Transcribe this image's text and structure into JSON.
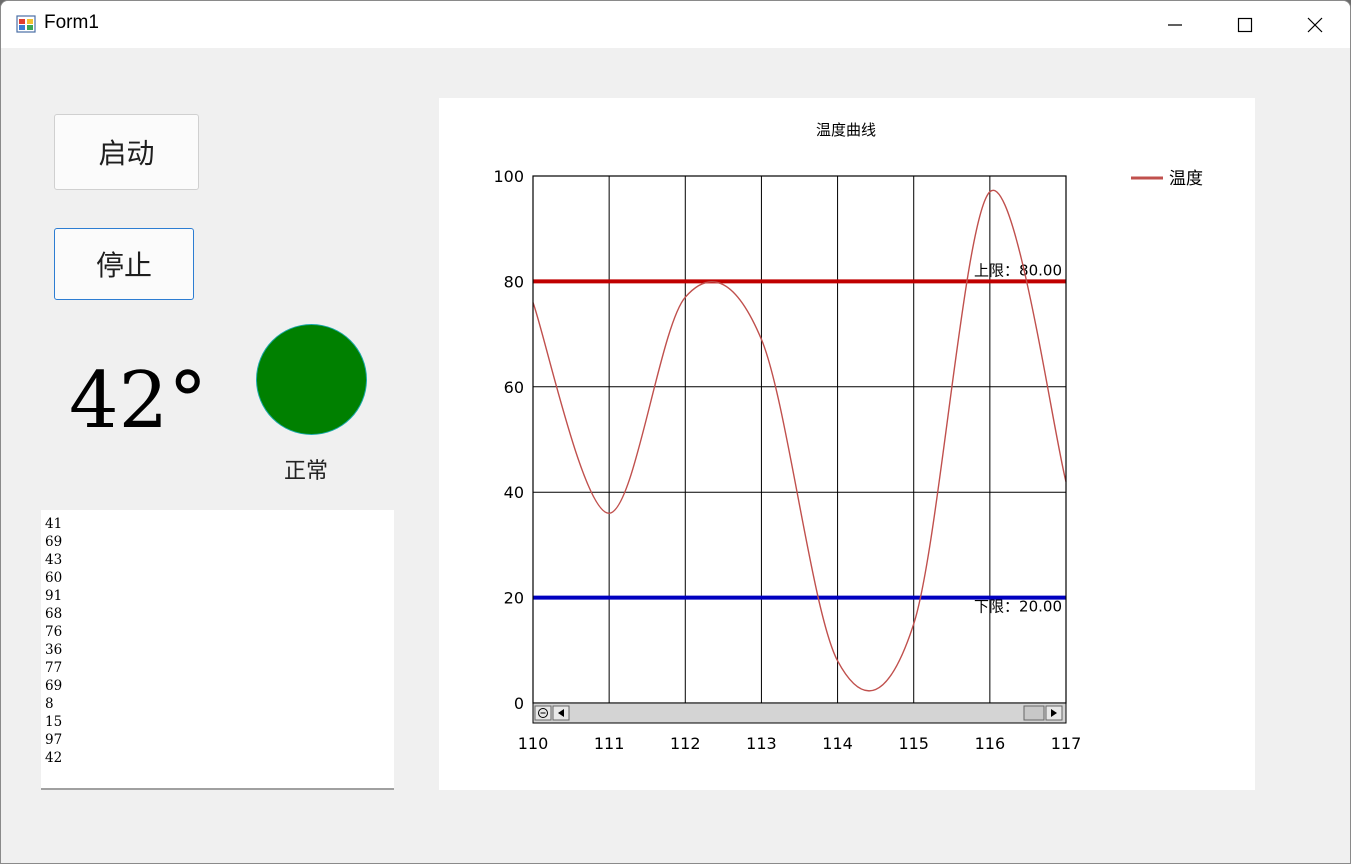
{
  "window": {
    "title": "Form1",
    "controls": {
      "minimize": "minimize-icon",
      "maximize": "maximize-icon",
      "close": "close-icon"
    }
  },
  "buttons": {
    "start_label": "启动",
    "stop_label": "停止"
  },
  "temperature": {
    "value_text": "42°",
    "status_text": "正常",
    "status_color": "#008000"
  },
  "log_values": [
    "41",
    "69",
    "43",
    "60",
    "91",
    "68",
    "76",
    "36",
    "77",
    "69",
    "8",
    "15",
    "97",
    "42"
  ],
  "chart_data": {
    "type": "line",
    "title": "温度曲线",
    "xlim": [
      110,
      117
    ],
    "ylim": [
      0,
      100
    ],
    "x_ticks": [
      "110",
      "111",
      "112",
      "113",
      "114",
      "115",
      "116",
      "117"
    ],
    "y_ticks": [
      "0",
      "20",
      "40",
      "60",
      "80",
      "100"
    ],
    "grid": true,
    "legend_position": "top-right",
    "series": [
      {
        "name": "温度",
        "color": "#c0504d",
        "x": [
          110,
          111,
          112,
          113,
          114,
          115,
          116,
          117
        ],
        "y": [
          76,
          36,
          77,
          69,
          8,
          15,
          97,
          42
        ]
      }
    ],
    "upper_limit": {
      "value": 80,
      "label": "上限：80.00",
      "color": "#c00000"
    },
    "lower_limit": {
      "value": 20,
      "label": "下限：20.00",
      "color": "#0000c0"
    },
    "scrollbar": true
  }
}
